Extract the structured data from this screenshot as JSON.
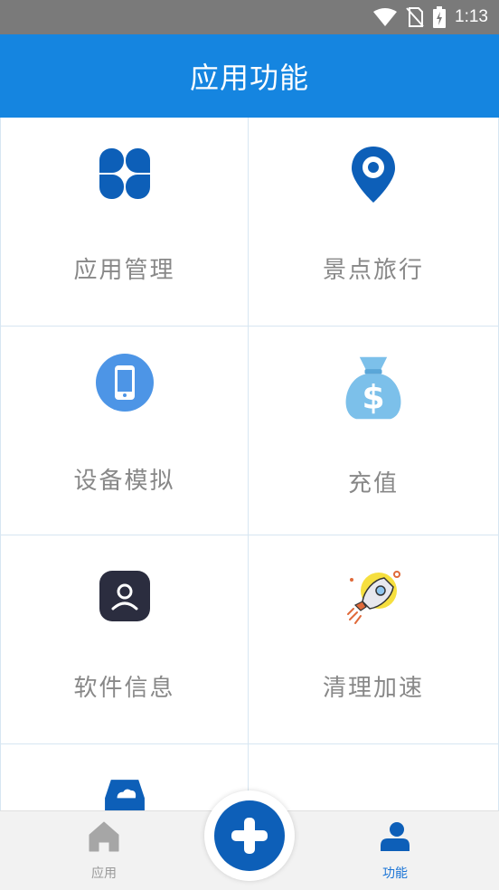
{
  "status_bar": {
    "time": "1:13"
  },
  "header": {
    "title": "应用功能"
  },
  "grid": {
    "items": [
      {
        "label": "应用管理",
        "icon": "app-grid-icon"
      },
      {
        "label": "景点旅行",
        "icon": "location-pin-icon"
      },
      {
        "label": "设备模拟",
        "icon": "phone-icon"
      },
      {
        "label": "充值",
        "icon": "money-bag-icon"
      },
      {
        "label": "软件信息",
        "icon": "user-badge-icon"
      },
      {
        "label": "清理加速",
        "icon": "rocket-icon"
      },
      {
        "label": "",
        "icon": "cloud-icon"
      }
    ]
  },
  "bottom_nav": {
    "items": [
      {
        "label": "应用",
        "icon": "home-icon",
        "active": false
      },
      {
        "label": "功能",
        "icon": "person-icon",
        "active": true
      }
    ],
    "fab_icon": "plus-icon"
  },
  "colors": {
    "header": "#1585e0",
    "accent": "#0d5fb8",
    "inactive": "#999999",
    "active": "#1a74d6"
  }
}
